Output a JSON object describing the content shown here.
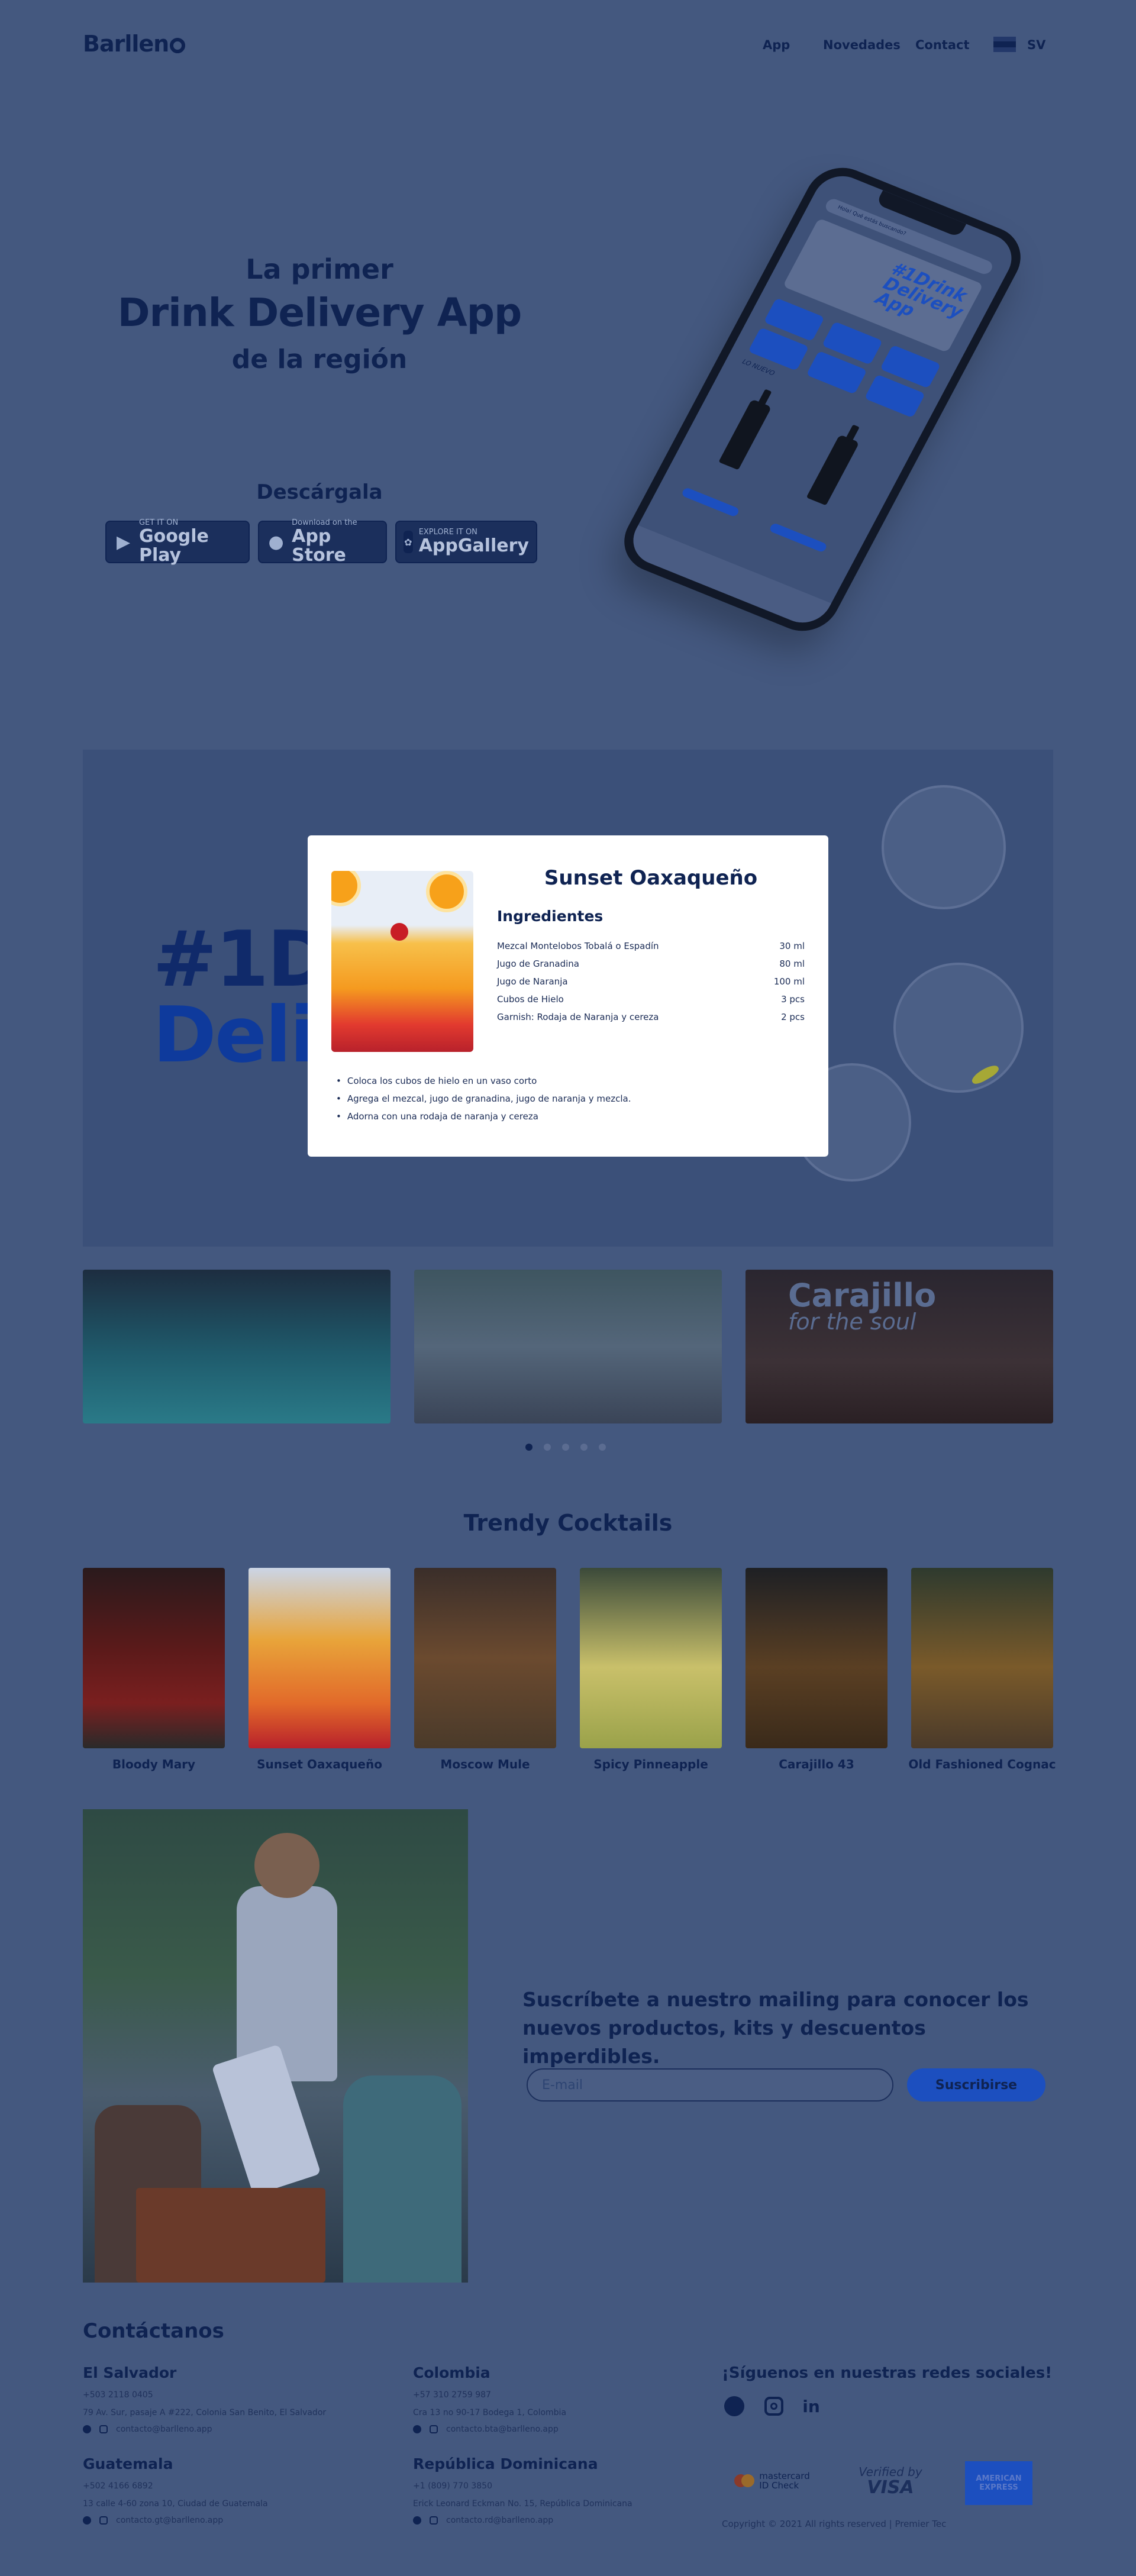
{
  "header": {
    "logo": "Barllen",
    "nav": [
      "App",
      "Novedades",
      "Contact"
    ],
    "country": "SV"
  },
  "hero": {
    "line1": "La primer",
    "title": "Drink Delivery App",
    "line3": "de la región",
    "download_label": "Descárgala",
    "stores": [
      {
        "small": "GET IT ON",
        "big": "Google Play",
        "icon": "google-play-icon"
      },
      {
        "small": "Download on the",
        "big": "App Store",
        "icon": "apple-icon"
      },
      {
        "small": "EXPLORE IT ON",
        "big": "AppGallery",
        "icon": "huawei-icon"
      }
    ],
    "phone": {
      "search_placeholder": "Hola! Qué estás buscando?",
      "promo": "#1Drink Delivery App",
      "section_label": "LO NUEVO"
    }
  },
  "banner": {
    "text_line1": "#1D",
    "text_line2": "Deli"
  },
  "modal": {
    "title": "Sunset Oaxaqueño",
    "ingredients_title": "Ingredientes",
    "ingredients": [
      {
        "name": "Mezcal Montelobos Tobalá o Espadín",
        "qty": "30 ml"
      },
      {
        "name": "Jugo de Granadina",
        "qty": "80 ml"
      },
      {
        "name": "Jugo de Naranja",
        "qty": "100 ml"
      },
      {
        "name": "Cubos de Hielo",
        "qty": "3 pcs"
      },
      {
        "name": "Garnish: Rodaja de Naranja y cereza",
        "qty": "2 pcs"
      }
    ],
    "steps": [
      "Coloca los cubos de hielo en un vaso corto",
      "Agrega el mezcal, jugo de granadina, jugo de naranja y mezcla.",
      "Adorna con una rodaja de naranja y cereza"
    ]
  },
  "slider": {
    "thumb3_title": "Carajillo",
    "thumb3_sub": "for the soul",
    "dots": 5,
    "active_dot": 0
  },
  "trendy": {
    "title": "Trendy Cocktails",
    "items": [
      {
        "name": "Bloody Mary",
        "color": "#7a1f1f"
      },
      {
        "name": "Sunset Oaxaqueño",
        "color": "#e89a2a"
      },
      {
        "name": "Moscow Mule",
        "color": "#6b4a2f"
      },
      {
        "name": "Spicy Pinneapple",
        "color": "#c9c06a"
      },
      {
        "name": "Carajillo 43",
        "color": "#5a3f23"
      },
      {
        "name": "Old Fashioned Cognac",
        "color": "#7a5a2a"
      }
    ]
  },
  "mailing": {
    "text": "Suscríbete a nuestro mailing para conocer los nuevos productos, kits y descuentos imperdibles.",
    "email_placeholder": "E-mail",
    "button": "Suscribirse"
  },
  "footer": {
    "title": "Contáctanos",
    "countries": [
      {
        "name": "El Salvador",
        "phone": "+503 2118 0405",
        "address": "79 Av. Sur, pasaje A #222, Colonia San Benito, El Salvador",
        "email": "contacto@barlleno.app"
      },
      {
        "name": "Colombia",
        "phone": "+57 310 2759 987",
        "address": "Cra 13 no 90-17 Bodega 1, Colombia",
        "email": "contacto.bta@barlleno.app"
      },
      {
        "name": "Guatemala",
        "phone": "+502 4166 6892",
        "address": "13 calle 4-60 zona 10, Ciudad de Guatemala",
        "email": "contacto.gt@barlleno.app"
      },
      {
        "name": "República Dominicana",
        "phone": "+1 (809) 770 3850",
        "address": "Erick Leonard Eckman No. 15, República Dominicana",
        "email": "contacto.rd@barlleno.app"
      }
    ],
    "social_title": "¡Síguenos en nuestras redes sociales!",
    "payments": [
      {
        "line1": "mastercard",
        "line2": "ID Check"
      },
      {
        "line1": "Verified by",
        "line2": "VISA"
      },
      {
        "line1": "AMERICAN",
        "line2": "EXPRESS"
      }
    ],
    "copyright": "Copyright © 2021 All rights reserved | Premier Tec"
  }
}
